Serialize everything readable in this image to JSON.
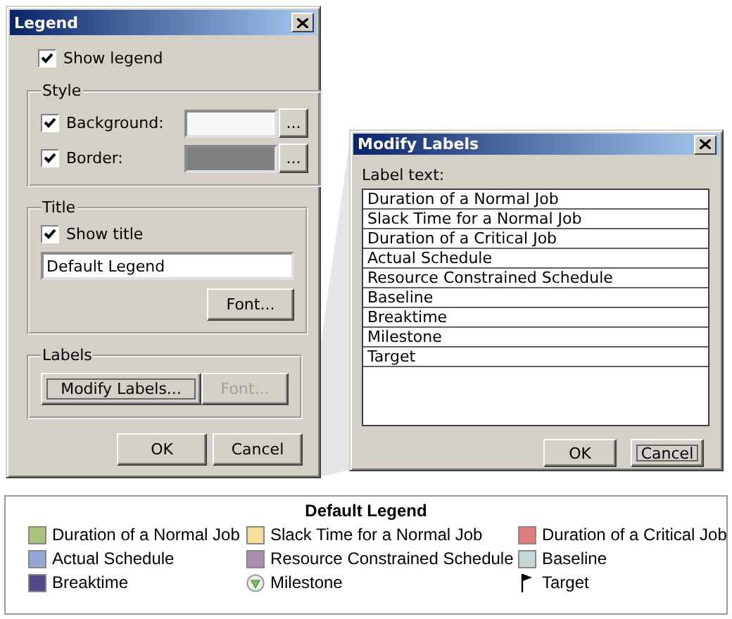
{
  "legend_dialog": {
    "title": "Legend",
    "show_legend": {
      "label": "Show legend",
      "checked": true
    },
    "style_group": {
      "title": "Style",
      "rows": [
        {
          "label": "Background:",
          "checked": true,
          "color": "#f8f8f8",
          "button": "..."
        },
        {
          "label": "Border:",
          "checked": true,
          "color": "#808080",
          "button": "..."
        }
      ]
    },
    "title_group": {
      "title": "Title",
      "show_title": {
        "label": "Show title",
        "checked": true
      },
      "title_field": {
        "value": "Default Legend"
      },
      "font_button": {
        "label": "Font...",
        "disabled": false
      }
    },
    "labels_group": {
      "title": "Labels",
      "modify_button": {
        "label": "Modify Labels...",
        "disabled": false,
        "focused": true
      },
      "font_button": {
        "label": "Font...",
        "disabled": true,
        "focused": false
      }
    },
    "buttons": [
      {
        "label": "OK",
        "focused": false
      },
      {
        "label": "Cancel",
        "focused": false
      }
    ]
  },
  "modify_labels_dialog": {
    "title": "Modify Labels",
    "list_label": "Label text:",
    "labels": [
      "Duration of a Normal Job",
      "Slack Time for a Normal Job",
      "Duration of a Critical Job",
      "Actual Schedule",
      "Resource Constrained Schedule",
      "Baseline",
      "Breaktime",
      "Milestone",
      "Target"
    ],
    "buttons": [
      {
        "label": "OK",
        "focused": false
      },
      {
        "label": "Cancel",
        "focused": true
      }
    ]
  },
  "legend": {
    "title": "Default Legend",
    "items": [
      {
        "label": "Duration of a Normal Job",
        "kind": "swatch",
        "color": "#a8c47c"
      },
      {
        "label": "Slack Time for a Normal Job",
        "kind": "swatch",
        "color": "#f4e09c"
      },
      {
        "label": "Duration of a Critical Job",
        "kind": "swatch",
        "color": "#e07c7c"
      },
      {
        "label": "Actual Schedule",
        "kind": "swatch",
        "color": "#94a8d4"
      },
      {
        "label": "Resource Constrained Schedule",
        "kind": "swatch",
        "color": "#a890ac"
      },
      {
        "label": "Baseline",
        "kind": "swatch",
        "color": "#c4d8d8"
      },
      {
        "label": "Breaktime",
        "kind": "swatch",
        "color": "#544888"
      },
      {
        "label": "Milestone",
        "kind": "milestone"
      },
      {
        "label": "Target",
        "kind": "flag"
      }
    ]
  }
}
